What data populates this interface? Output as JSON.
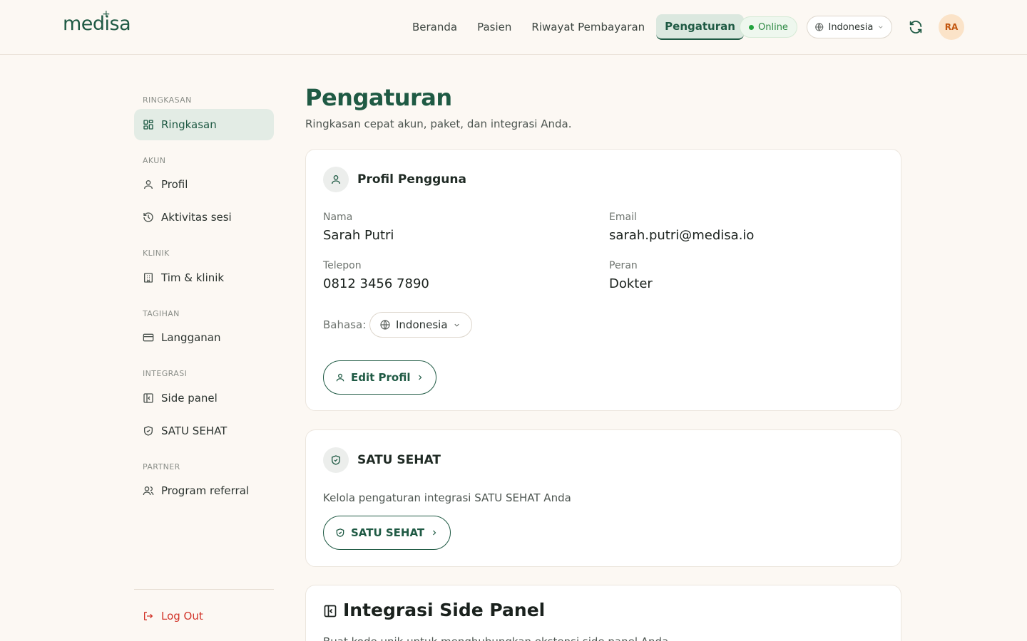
{
  "brand": {
    "logo_text": "medisa"
  },
  "nav": {
    "links": [
      {
        "label": "Beranda"
      },
      {
        "label": "Pasien"
      },
      {
        "label": "Riwayat Pembayaran"
      },
      {
        "label": "Pengaturan",
        "active": true
      }
    ],
    "status": "Online",
    "language": "Indonesia",
    "avatar_initials": "RA"
  },
  "sidebar": {
    "sections": [
      {
        "label": "RINGKASAN",
        "items": [
          {
            "label": "Ringkasan",
            "icon": "dashboard-icon",
            "active": true
          }
        ]
      },
      {
        "label": "AKUN",
        "items": [
          {
            "label": "Profil",
            "icon": "user-icon"
          },
          {
            "label": "Aktivitas sesi",
            "icon": "history-icon"
          }
        ]
      },
      {
        "label": "KLINIK",
        "items": [
          {
            "label": "Tim & klinik",
            "icon": "building-icon"
          }
        ]
      },
      {
        "label": "TAGIHAN",
        "items": [
          {
            "label": "Langganan",
            "icon": "credit-card-icon"
          }
        ]
      },
      {
        "label": "INTEGRASI",
        "items": [
          {
            "label": "Side panel",
            "icon": "side-panel-icon"
          },
          {
            "label": "SATU SEHAT",
            "icon": "shield-check-icon"
          }
        ]
      },
      {
        "label": "PARTNER",
        "items": [
          {
            "label": "Program referral",
            "icon": "users-icon"
          }
        ]
      }
    ],
    "logout_label": "Log Out"
  },
  "main": {
    "title": "Pengaturan",
    "subtitle": "Ringkasan cepat akun, paket, dan integrasi Anda.",
    "profile_card": {
      "title": "Profil Pengguna",
      "fields": {
        "name_label": "Nama",
        "name_value": "Sarah Putri",
        "email_label": "Email",
        "email_value": "sarah.putri@medisa.io",
        "phone_label": "Telepon",
        "phone_value": "0812 3456 7890",
        "role_label": "Peran",
        "role_value": "Dokter"
      },
      "language_label": "Bahasa:",
      "language_value": "Indonesia",
      "edit_button": "Edit Profil"
    },
    "satusehat_card": {
      "title": "SATU SEHAT",
      "description": "Kelola pengaturan integrasi SATU SEHAT Anda",
      "button": "SATU SEHAT"
    },
    "sidepanel_card": {
      "title": "Integrasi Side Panel",
      "description": "Buat kode unik untuk menghubungkan ekstensi side panel Anda."
    }
  },
  "colors": {
    "brand": "#1f5a44",
    "online": "#22a33e",
    "danger": "#d2352a",
    "avatar_bg": "#fbe3c8"
  }
}
